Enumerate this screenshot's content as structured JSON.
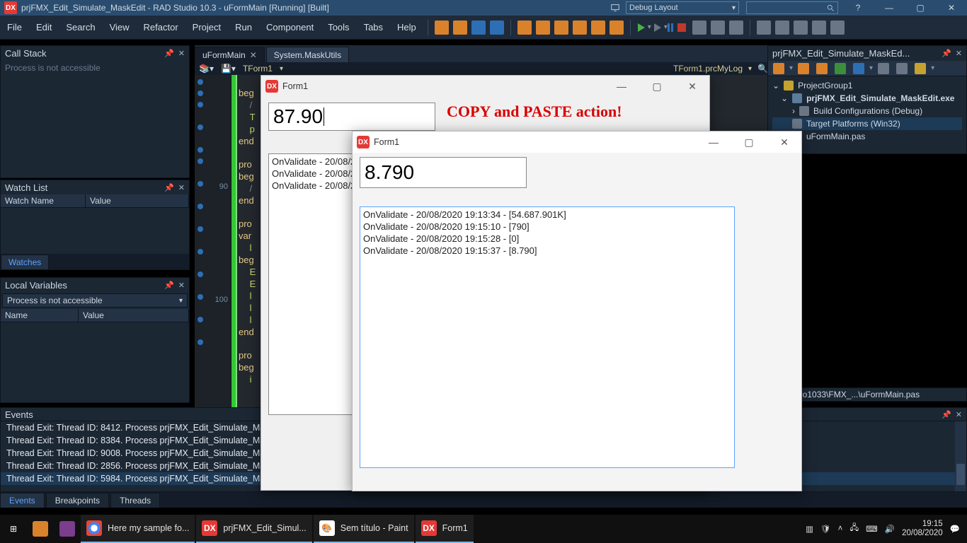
{
  "titlebar": {
    "text": "prjFMX_Edit_Simulate_MaskEdit - RAD Studio 10.3 - uFormMain [Running] [Built]",
    "layout_combo": "Debug Layout",
    "help_symbol": "?"
  },
  "menu": {
    "items": [
      "File",
      "Edit",
      "Search",
      "View",
      "Refactor",
      "Project",
      "Run",
      "Component",
      "Tools",
      "Tabs",
      "Help"
    ]
  },
  "left_panels": {
    "callstack": {
      "title": "Call Stack",
      "body": "Process is not accessible"
    },
    "watch": {
      "title": "Watch List",
      "cols": [
        "Watch Name",
        "Value"
      ],
      "tab": "Watches"
    },
    "locals": {
      "title": "Local Variables",
      "combo": "Process is not accessible",
      "cols": [
        "Name",
        "Value"
      ]
    }
  },
  "editor": {
    "tabs": [
      {
        "label": "uFormMain",
        "active": true
      },
      {
        "label": "System.MaskUtils",
        "active": false
      }
    ],
    "crumb_left": "TForm1",
    "crumb_right": "TForm1.prcMyLog",
    "line_labels": {
      "ln90": "90",
      "ln100": "100"
    },
    "code_fragments": {
      "beg1": "beg",
      "slash1": "/",
      "t1": "T",
      "p1": "p",
      "end1": "end",
      "pro1": "pro",
      "beg2": "beg",
      "slash2": "/",
      "end2": "end",
      "pro2": "pro",
      "var1": "var",
      "l1": "l",
      "beg3": "beg",
      "e1": "E",
      "e2": "E",
      "l2": "l",
      "l3": "l",
      "l4": "l",
      "end3": "end",
      "pro3": "pro",
      "beg4": "beg",
      "i1": "i"
    }
  },
  "project": {
    "title": "prjFMX_Edit_Simulate_MaskEd...",
    "nodes": {
      "group": "ProjectGroup1",
      "exe": "prjFMX_Edit_Simulate_MaskEdit.exe",
      "build": "Build Configurations (Debug)",
      "target": "Target Platforms (Win32)",
      "unit": "uFormMain.pas"
    },
    "path": "Tests\\Rio1033\\FMX_...\\uFormMain.pas"
  },
  "events": {
    "title": "Events",
    "rows": [
      "Thread Exit: Thread ID: 8412. Process prjFMX_Edit_Simulate_MaskE",
      "Thread Exit: Thread ID: 8384. Process prjFMX_Edit_Simulate_MaskEdit.exe (9388)",
      "Thread Exit: Thread ID: 9008. Process prjFMX_Edit_Simulate_MaskEdit.exe (9388)",
      "Thread Exit: Thread ID: 2856. Process prjFMX_Edit_Simulate_MaskEdit.exe (9388)",
      "Thread Exit: Thread ID: 5984. Process prjFMX_Edit_Simulate_MaskEdit.exe (9388)"
    ],
    "tabs": [
      "Events",
      "Breakpoints",
      "Threads"
    ]
  },
  "form1_back": {
    "title": "Form1",
    "edit_value": "87.90",
    "copy_line": "COPY and PASTE action!",
    "log": [
      "OnValidate - 20/08/20",
      "OnValidate - 20/08/20",
      "OnValidate - 20/08/20"
    ]
  },
  "form1_front": {
    "title": "Form1",
    "edit_value": "8.790",
    "log": [
      "OnValidate - 20/08/2020 19:13:34 - [54.687.901K]",
      "OnValidate - 20/08/2020 19:15:10 - [790]",
      "OnValidate - 20/08/2020 19:15:28 - [0]",
      "OnValidate - 20/08/2020 19:15:37 - [8.790]"
    ]
  },
  "taskbar": {
    "items": [
      {
        "label": "",
        "kind": "start"
      },
      {
        "label": "",
        "kind": "explorer"
      },
      {
        "label": "",
        "kind": "winrar"
      },
      {
        "label": "Here my sample fo...",
        "kind": "chrome"
      },
      {
        "label": "prjFMX_Edit_Simul...",
        "kind": "delphi"
      },
      {
        "label": "Sem título - Paint",
        "kind": "paint"
      },
      {
        "label": "Form1",
        "kind": "delphi"
      }
    ],
    "clock_time": "19:15",
    "clock_date": "20/08/2020"
  }
}
